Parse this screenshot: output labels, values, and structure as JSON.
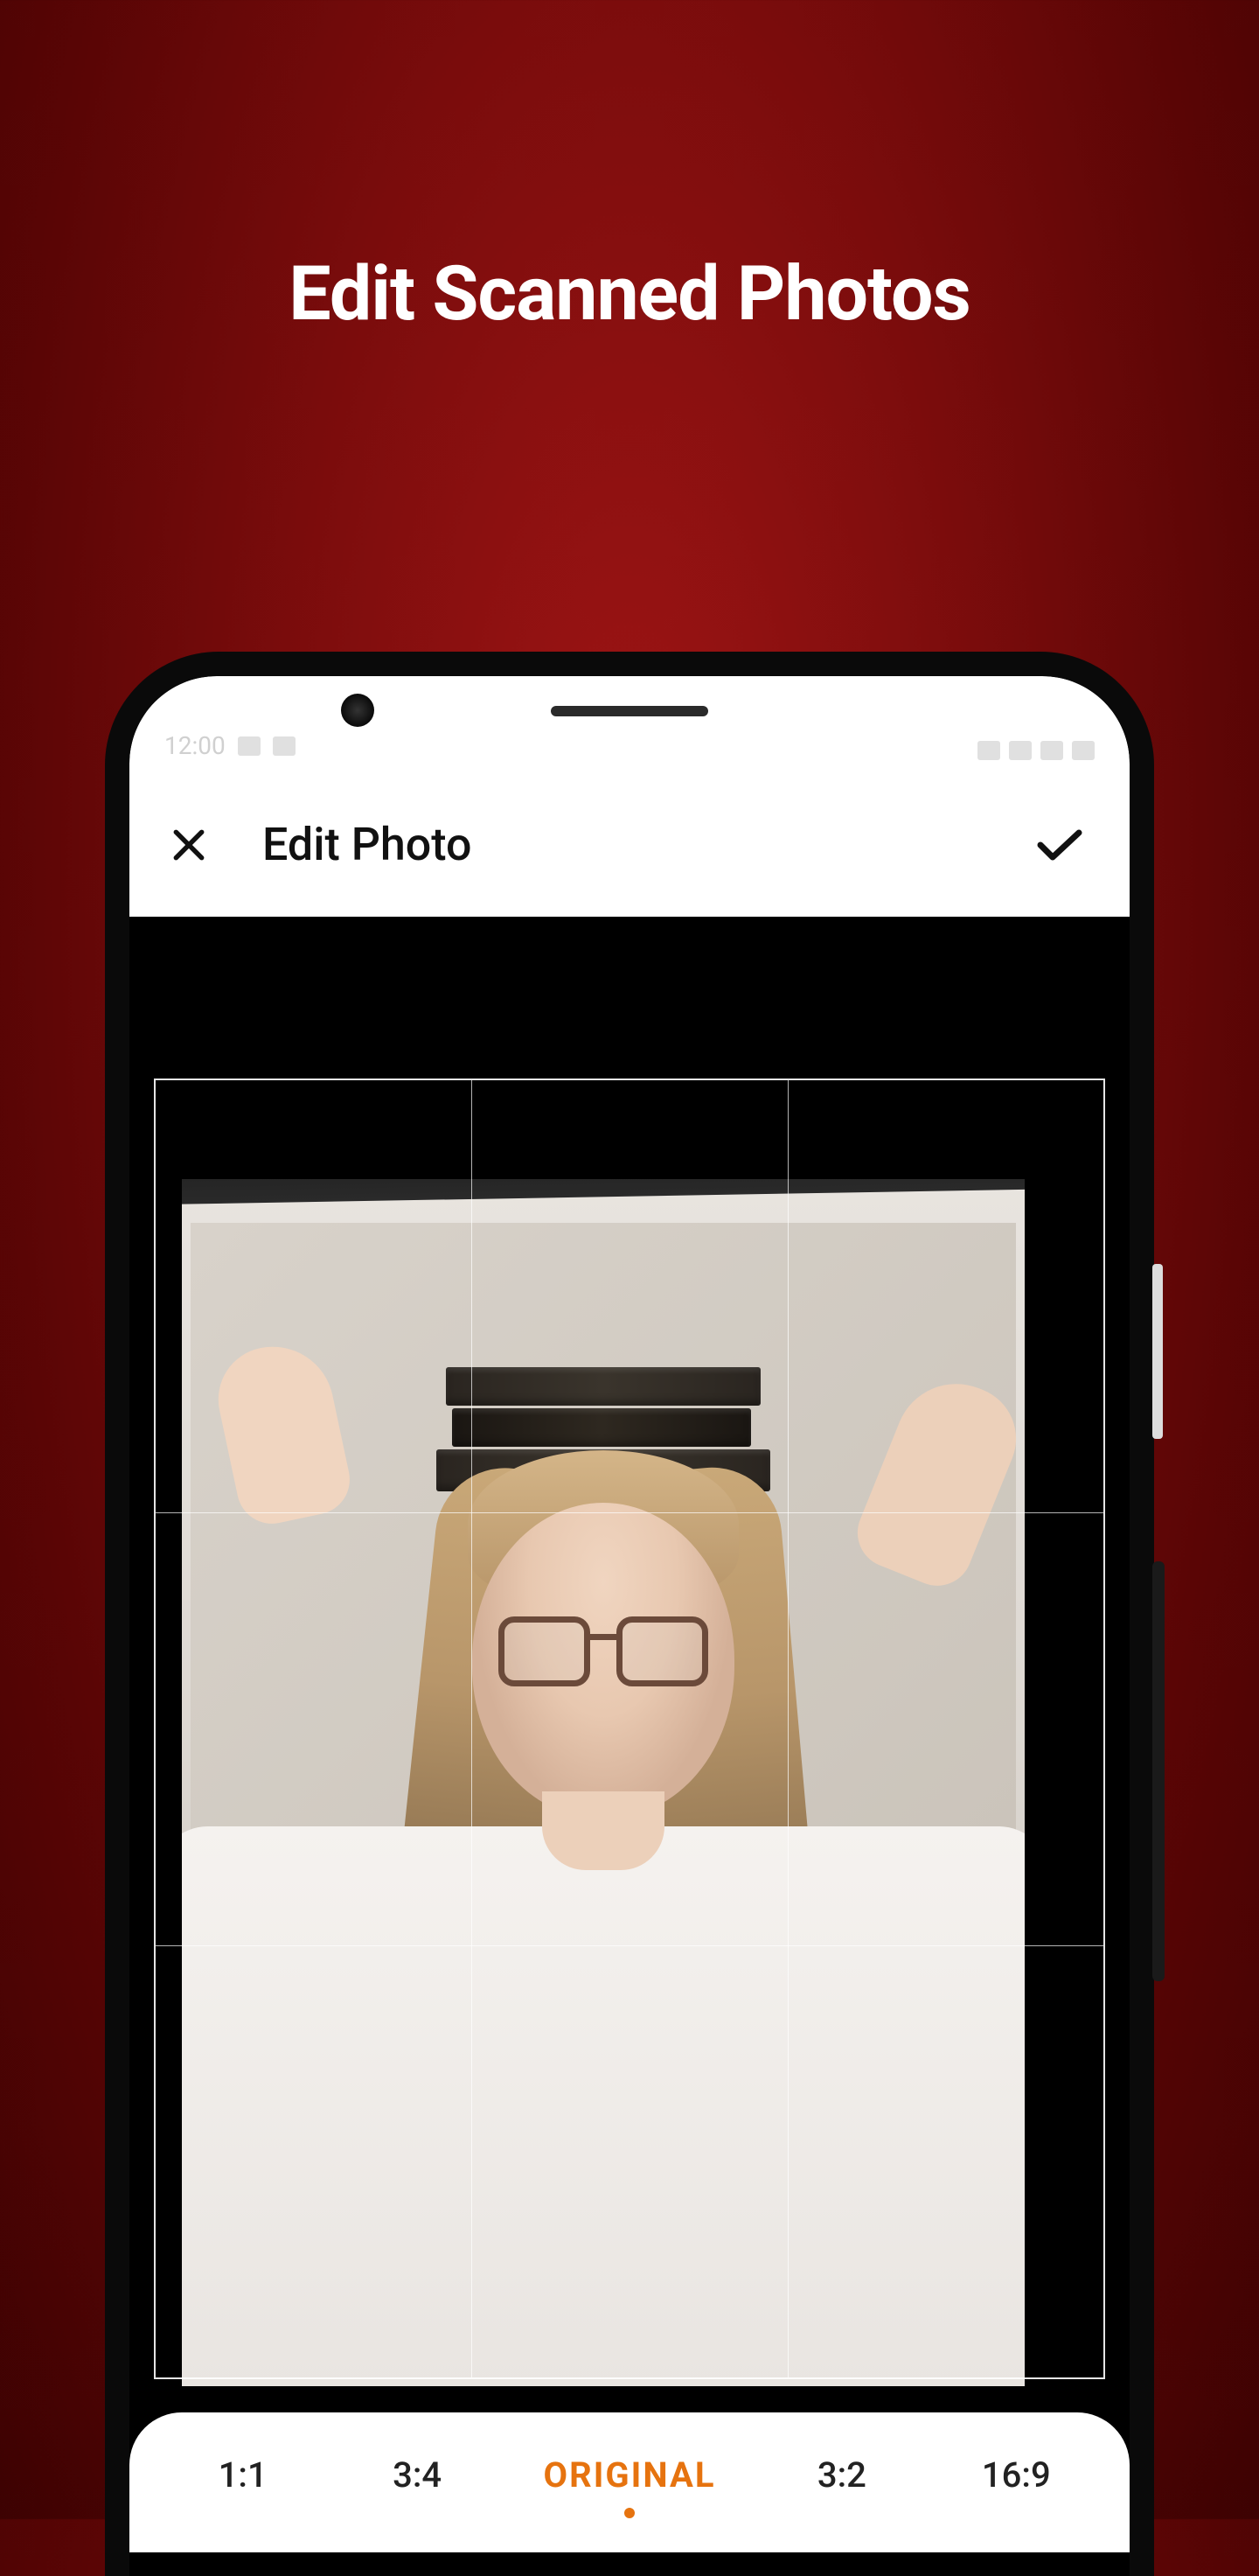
{
  "hero": {
    "title": "Edit Scanned Photos"
  },
  "status_bar": {
    "time": "12:00"
  },
  "app_bar": {
    "title": "Edit Photo"
  },
  "ratios": {
    "items": [
      {
        "label": "1:1"
      },
      {
        "label": "3:4"
      },
      {
        "label": "ORIGINAL"
      },
      {
        "label": "3:2"
      },
      {
        "label": "16:9"
      }
    ],
    "active_index": 2
  },
  "colors": {
    "accent": "#e6730f",
    "bg_red": "#7a0c0c"
  },
  "icons": {
    "close": "close-icon",
    "confirm": "check-icon"
  }
}
